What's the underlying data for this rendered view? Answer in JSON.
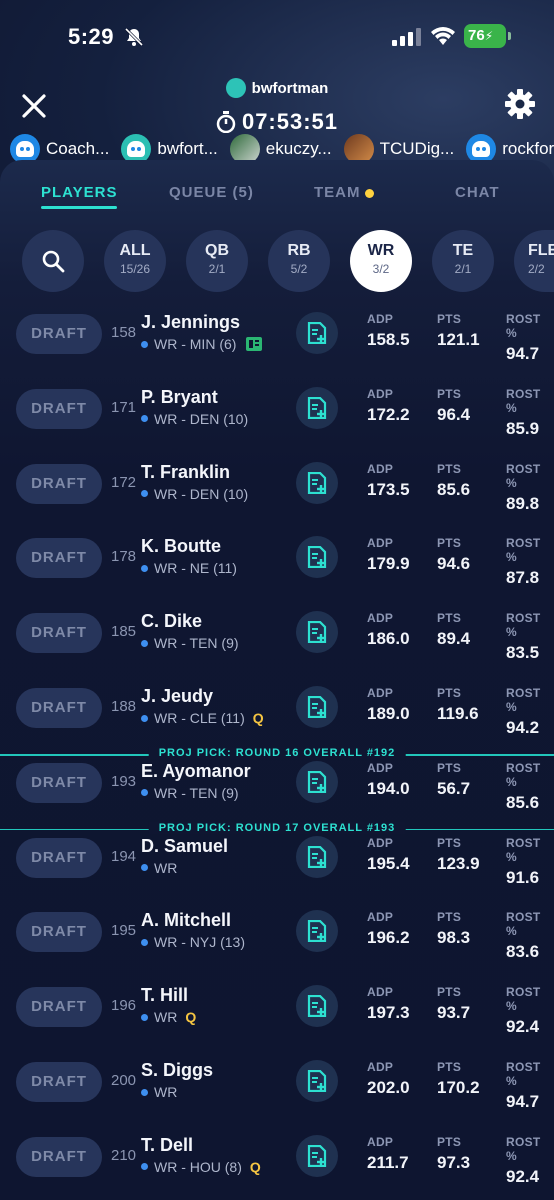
{
  "status": {
    "time": "5:29",
    "battery": "76"
  },
  "header": {
    "drafter": "bwfortman",
    "timer": "07:53:51"
  },
  "drafters": [
    {
      "name": "Coach...",
      "avatar": "robot"
    },
    {
      "name": "bwfort...",
      "avatar": "teal-robot"
    },
    {
      "name": "ekuczy...",
      "avatar": "photo"
    },
    {
      "name": "TCUDig...",
      "avatar": "photo"
    },
    {
      "name": "rockfor...",
      "avatar": "robot"
    }
  ],
  "tabs": [
    {
      "label": "PLAYERS",
      "active": true
    },
    {
      "label": "QUEUE (5)"
    },
    {
      "label": "TEAM",
      "dot": true
    },
    {
      "label": "CHAT"
    }
  ],
  "filters": [
    {
      "pos": "ALL",
      "count": "15/26"
    },
    {
      "pos": "QB",
      "count": "2/1"
    },
    {
      "pos": "RB",
      "count": "5/2"
    },
    {
      "pos": "WR",
      "count": "3/2",
      "active": true
    },
    {
      "pos": "TE",
      "count": "2/1"
    },
    {
      "pos": "FLEX",
      "count": "2/2"
    }
  ],
  "stat_labels": {
    "adp": "ADP",
    "pts": "PTS",
    "rost": "ROST %"
  },
  "draft_label": "DRAFT",
  "players": [
    {
      "rank": "158",
      "name": "J. Jennings",
      "info": "WR - MIN (6)",
      "news": true,
      "adp": "158.5",
      "pts": "121.1",
      "rost": "94.7"
    },
    {
      "rank": "171",
      "name": "P. Bryant",
      "info": "WR - DEN (10)",
      "adp": "172.2",
      "pts": "96.4",
      "rost": "85.9"
    },
    {
      "rank": "172",
      "name": "T. Franklin",
      "info": "WR - DEN (10)",
      "adp": "173.5",
      "pts": "85.6",
      "rost": "89.8"
    },
    {
      "rank": "178",
      "name": "K. Boutte",
      "info": "WR - NE (11)",
      "adp": "179.9",
      "pts": "94.6",
      "rost": "87.8"
    },
    {
      "rank": "185",
      "name": "C. Dike",
      "info": "WR - TEN (9)",
      "adp": "186.0",
      "pts": "89.4",
      "rost": "83.5"
    },
    {
      "rank": "188",
      "name": "J. Jeudy",
      "info": "WR - CLE (11)",
      "q": "Q",
      "adp": "189.0",
      "pts": "119.6",
      "rost": "94.2"
    },
    {
      "rank": "193",
      "name": "E. Ayomanor",
      "info": "WR - TEN (9)",
      "adp": "194.0",
      "pts": "56.7",
      "rost": "85.6"
    },
    {
      "rank": "194",
      "name": "D. Samuel",
      "info": "WR",
      "adp": "195.4",
      "pts": "123.9",
      "rost": "91.6"
    },
    {
      "rank": "195",
      "name": "A. Mitchell",
      "info": "WR - NYJ (13)",
      "adp": "196.2",
      "pts": "98.3",
      "rost": "83.6"
    },
    {
      "rank": "196",
      "name": "T. Hill",
      "info": "WR",
      "q": "Q",
      "adp": "197.3",
      "pts": "93.7",
      "rost": "92.4"
    },
    {
      "rank": "200",
      "name": "S. Diggs",
      "info": "WR",
      "adp": "202.0",
      "pts": "170.2",
      "rost": "94.7"
    },
    {
      "rank": "210",
      "name": "T. Dell",
      "info": "WR - HOU (8)",
      "q": "Q",
      "adp": "211.7",
      "pts": "97.3",
      "rost": "92.4"
    }
  ],
  "dividers": [
    {
      "label": "PROJ PICK: ROUND 16 OVERALL #192",
      "after": 5
    },
    {
      "label": "PROJ PICK: ROUND 17 OVERALL #193",
      "after": 6
    }
  ],
  "colors": {
    "accent": "#2de1d1",
    "question": "#f5c542",
    "dot": "#3e8ff0"
  }
}
